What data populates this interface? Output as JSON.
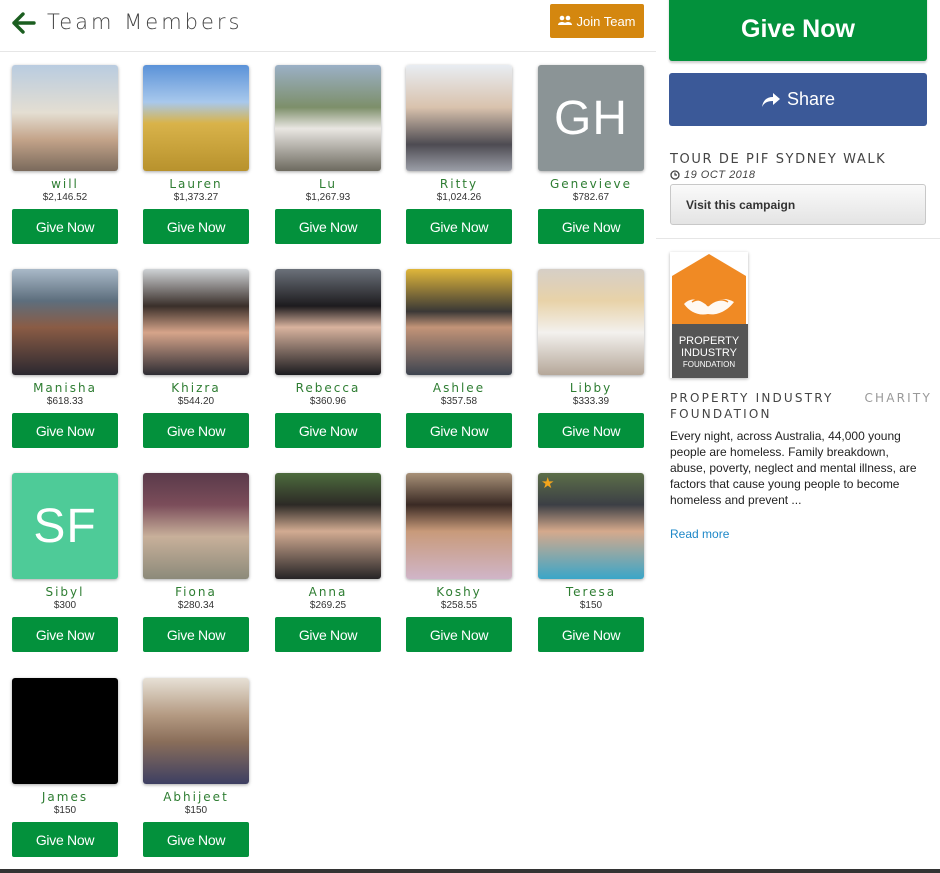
{
  "header": {
    "title": "Team Members",
    "join_label": "Join Team"
  },
  "members": [
    {
      "name": "will",
      "amount": "$2,146.52",
      "give_label": "Give Now",
      "avatar": "photo",
      "bg": "linear-gradient(180deg,#b9cce0 0%,#e4ded2 45%,#c4a48a 70%,#7a6a5c 100%)"
    },
    {
      "name": "Lauren",
      "amount": "$1,373.27",
      "give_label": "Give Now",
      "avatar": "photo",
      "bg": "linear-gradient(180deg,#5b92d8 0%,#a8c8ec 35%,#d9b34a 55%,#b8922d 100%)"
    },
    {
      "name": "Lu",
      "amount": "$1,267.93",
      "give_label": "Give Now",
      "avatar": "photo",
      "bg": "linear-gradient(180deg,#9bb0c6 0%,#7d8f6a 40%,#e9e6e2 60%,#6d6a5f 100%)"
    },
    {
      "name": "Ritty",
      "amount": "$1,024.26",
      "give_label": "Give Now",
      "avatar": "photo",
      "bg": "linear-gradient(180deg,#e8edf2 0%,#d9c2ad 40%,#4d4b52 75%,#9c9fa8 100%)"
    },
    {
      "name": "Genevieve",
      "amount": "$782.67",
      "give_label": "Give Now",
      "avatar": "initials",
      "initials": "GH",
      "bg": "#8b9496"
    },
    {
      "name": "Manisha",
      "amount": "$618.33",
      "give_label": "Give Now",
      "avatar": "photo",
      "bg": "linear-gradient(180deg,#a9b9c8 0%,#5d6e7d 30%,#8a5c45 55%,#2b2830 100%)"
    },
    {
      "name": "Khizra",
      "amount": "$544.20",
      "give_label": "Give Now",
      "avatar": "photo",
      "bg": "linear-gradient(180deg,#cfd3d6 0%,#3a2f2a 35%,#d6a48a 60%,#2e2d34 100%)"
    },
    {
      "name": "Rebecca",
      "amount": "$360.96",
      "give_label": "Give Now",
      "avatar": "photo",
      "bg": "linear-gradient(180deg,#6b717a 0%,#1d1b1e 35%,#d9b39e 55%,#1b1b1f 100%)"
    },
    {
      "name": "Ashlee",
      "amount": "$357.58",
      "give_label": "Give Now",
      "avatar": "photo",
      "bg": "linear-gradient(180deg,#e0b63a 0%,#3a3836 40%,#c39478 55%,#3d4450 100%)"
    },
    {
      "name": "Libby",
      "amount": "$333.39",
      "give_label": "Give Now",
      "avatar": "photo",
      "bg": "linear-gradient(180deg,#d6cfc7 0%,#e8d2a8 30%,#f3f1ee 60%,#b5a799 100%)"
    },
    {
      "name": "Sibyl",
      "amount": "$300",
      "give_label": "Give Now",
      "avatar": "initials",
      "initials": "SF",
      "bg": "#4ecb98"
    },
    {
      "name": "Fiona",
      "amount": "$280.34",
      "give_label": "Give Now",
      "avatar": "photo",
      "bg": "linear-gradient(180deg,#5a3a4a 0%,#7b4d5a 30%,#c8b09a 60%,#8c8a7a 100%)"
    },
    {
      "name": "Anna",
      "amount": "$269.25",
      "give_label": "Give Now",
      "avatar": "photo",
      "bg": "linear-gradient(180deg,#4d6b3d 0%,#2d2a26 30%,#d2ab92 55%,#262426 100%)"
    },
    {
      "name": "Koshy",
      "amount": "$258.55",
      "give_label": "Give Now",
      "avatar": "photo",
      "bg": "linear-gradient(180deg,#a89178 0%,#3a2a24 30%,#c89a7a 55%,#d0b5c8 100%)"
    },
    {
      "name": "Teresa",
      "amount": "$150",
      "give_label": "Give Now",
      "avatar": "photo",
      "star": "★",
      "bg": "linear-gradient(180deg,#5c6e48 0%,#3c3f45 30%,#d5a98c 55%,#3aa6c8 100%)"
    },
    {
      "name": "James",
      "amount": "$150",
      "give_label": "Give Now",
      "avatar": "photo",
      "bg": "#000000"
    },
    {
      "name": "Abhijeet",
      "amount": "$150",
      "give_label": "Give Now",
      "avatar": "photo",
      "bg": "linear-gradient(180deg,#e7e1d6 0%,#b49a82 35%,#8a6e5a 60%,#3d3f62 100%)"
    }
  ],
  "sidebar": {
    "give_label": "Give Now",
    "share_label": "Share",
    "campaign_title": "TOUR DE PIF SYDNEY WALK",
    "campaign_date": "19 OCT 2018",
    "visit_label": "Visit this campaign",
    "charity_logo_text": [
      "PROPERTY",
      "INDUSTRY",
      "FOUNDATION"
    ],
    "charity_name": "PROPERTY INDUSTRY FOUNDATION",
    "charity_tag": "CHARITY",
    "charity_desc": "Every night, across Australia, 44,000 young people are homeless. Family breakdown, abuse, poverty, neglect and mental illness, are factors that cause young people to become homeless and prevent ...",
    "read_more": "Read more"
  },
  "colors": {
    "green": "#03913c",
    "orange": "#d4870f",
    "facebook": "#3b5998",
    "charity_orange": "#f08a24"
  },
  "icons": {
    "back": "arrow-left-icon",
    "join": "users-icon",
    "share": "share-icon",
    "date": "clock-icon"
  }
}
